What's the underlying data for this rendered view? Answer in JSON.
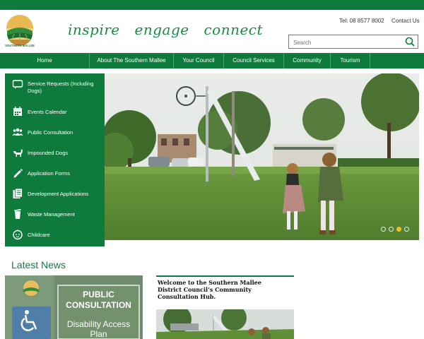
{
  "header": {
    "logo_text": "SOUTHERN MALLEE",
    "tagline": [
      "inspire",
      "engage",
      "connect"
    ],
    "phone": "Tel: 08 8577 8002",
    "contact_link": "Contact Us",
    "search_placeholder": "Search"
  },
  "nav": [
    "Home",
    "About The Southern Mallee",
    "Your Council",
    "Council Services",
    "Community",
    "Tourism"
  ],
  "sidebar": [
    {
      "label": "Service Requests (Including Dogs)",
      "icon": "chat-icon"
    },
    {
      "label": "Events Calendar",
      "icon": "calendar-icon"
    },
    {
      "label": "Public Consultation",
      "icon": "people-icon"
    },
    {
      "label": "Impounded Dogs",
      "icon": "dog-icon"
    },
    {
      "label": "Application Forms",
      "icon": "pencil-icon"
    },
    {
      "label": "Development Applications",
      "icon": "documents-icon"
    },
    {
      "label": "Waste Management",
      "icon": "bin-icon"
    },
    {
      "label": "Childcare",
      "icon": "child-face-icon"
    }
  ],
  "carousel": {
    "slides": 4,
    "active_slide": 3
  },
  "news": {
    "heading": "Latest News",
    "card1": {
      "line1": "PUBLIC",
      "line2": "CONSULTATION",
      "line3": "Disability Access",
      "line4": "Plan"
    },
    "card2": {
      "text": "Welcome to the Southern Mallee District Council’s Community Consultation Hub."
    }
  },
  "colors": {
    "brand_green": "#0e7a3b",
    "accent_yellow": "#f0c020"
  }
}
